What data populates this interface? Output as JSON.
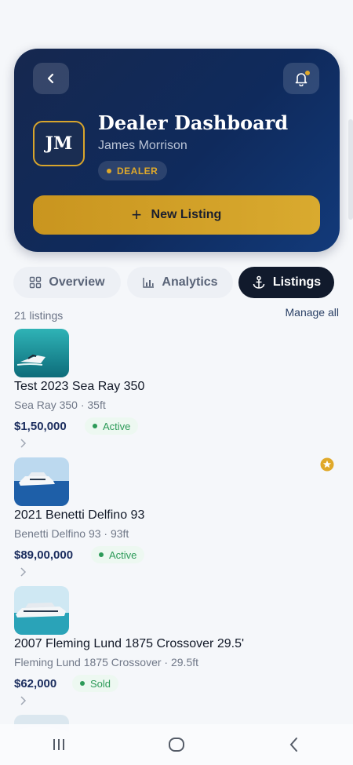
{
  "header": {
    "title": "Dealer Dashboard",
    "user_name": "James Morrison",
    "initials": "JM",
    "role_badge": "DEALER",
    "new_listing_label": "New Listing"
  },
  "tabs": [
    {
      "label": "Overview",
      "icon": "grid-icon",
      "active": false
    },
    {
      "label": "Analytics",
      "icon": "bar-chart-icon",
      "active": false
    },
    {
      "label": "Listings",
      "icon": "anchor-icon",
      "active": true
    }
  ],
  "listings_meta": {
    "count_label": "21 listings",
    "manage_label": "Manage all"
  },
  "listings": [
    {
      "title": "Test 2023 Sea Ray 350",
      "subtitle": "Sea Ray 350 · 35ft",
      "price": "$1,50,000",
      "status": "Active",
      "featured": false
    },
    {
      "title": "2021 Benetti Delfino 93",
      "subtitle": "Benetti Delfino 93 · 93ft",
      "price": "$89,00,000",
      "status": "Active",
      "featured": true
    },
    {
      "title": "2007 Fleming Lund 1875 Crossover 29.5'",
      "subtitle": "Fleming Lund 1875 Crossover · 29.5ft",
      "price": "$62,000",
      "status": "Sold",
      "featured": false
    }
  ],
  "colors": {
    "hero_bg": "#16284f",
    "accent_gold": "#d9aa2f",
    "active_tab": "#111a2c",
    "status_green": "#2c9a58",
    "price_navy": "#1b2d5e"
  }
}
